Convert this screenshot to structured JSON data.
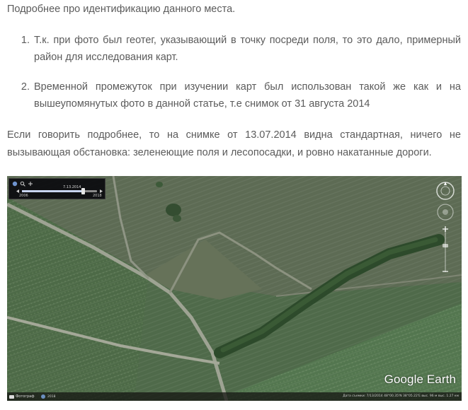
{
  "intro": "Подробнее про идентификацию данного места.",
  "list": [
    {
      "num": "1.",
      "text": "Т.к. при фото был геотег, указывающий в точку посреди поля, то это дало, примерный район для исследования карт."
    },
    {
      "num": "2.",
      "text": "Временной промежуток при изучении карт был использован такой же как и на вышеупомянутых фото в данной статье, т.е снимок от 31 августа 2014"
    }
  ],
  "paragraph": "Если говорить подробнее, то на снимке от 13.07.2014 видна стандартная, ничего не вызывающая обстановка: зеленеющие поля и лесопосадки, и ровно накатанные дороги.",
  "map": {
    "timeline": {
      "date": "7.13.2014",
      "start": "2006",
      "end": "2018",
      "position": 0.82
    },
    "logo": "Google Earth",
    "status": {
      "photos": "Фотограф",
      "year": "2018",
      "info": "Дата съемки: 7/13/2014   48°00.35'N  38°05.22'E  выс. 96 м   выс. 1.27 км"
    },
    "icons": {
      "timeline_left": "globe-icon",
      "timeline_mid": "search-icon",
      "compass": "compass-icon",
      "pan": "pan-icon",
      "zoom": "zoom-slider"
    },
    "colors": {
      "field_dark": "#3f5a3b",
      "field_light": "#6e8061",
      "road": "#9ea393",
      "trees": "#2f4a2c"
    }
  }
}
